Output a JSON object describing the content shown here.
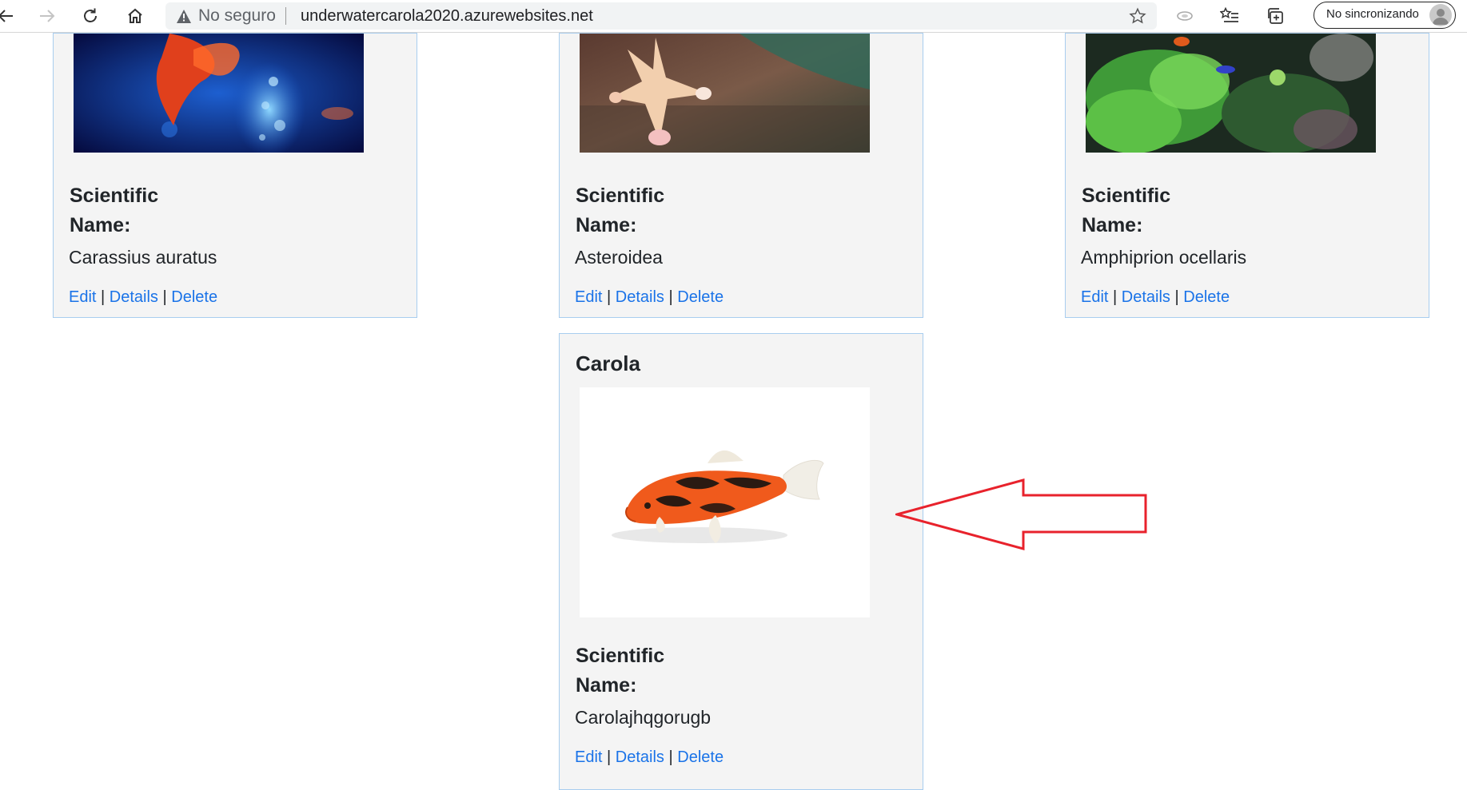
{
  "browser": {
    "security_label": "No seguro",
    "url": "underwatercarola2020.azurewebsites.net",
    "sync_label": "No sincronizando"
  },
  "links": {
    "edit": "Edit",
    "details": "Details",
    "delete": "Delete",
    "separator": "|"
  },
  "field_label_line1": "Scientific",
  "field_label_line2": "Name:",
  "cards": [
    {
      "scientific_name": "Carassius auratus"
    },
    {
      "scientific_name": "Asteroidea"
    },
    {
      "scientific_name": "Amphiprion ocellaris"
    },
    {
      "title": "Carola",
      "scientific_name": "Carolajhqgorugb"
    }
  ],
  "colors": {
    "link": "#1a73e8",
    "card_bg": "#f4f4f4",
    "card_border": "#a8cdef",
    "arrow": "#e8222c"
  }
}
